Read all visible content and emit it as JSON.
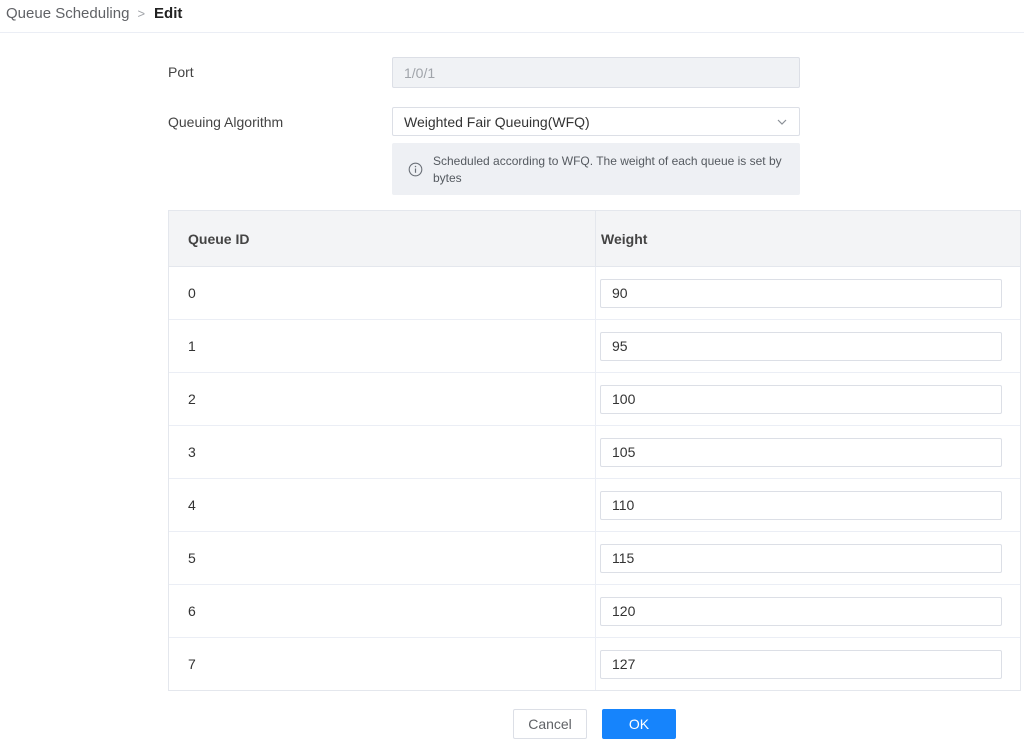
{
  "breadcrumb": {
    "parent": "Queue Scheduling",
    "separator": ">",
    "current": "Edit"
  },
  "form": {
    "port_label": "Port",
    "port_value": "1/0/1",
    "algorithm_label": "Queuing Algorithm",
    "algorithm_value": "Weighted Fair Queuing(WFQ)",
    "algorithm_icon": "chevron-down-icon",
    "info_icon": "info-circle-icon",
    "info_text": "Scheduled according to WFQ. The weight of each queue is set by bytes"
  },
  "table": {
    "headers": [
      "Queue ID",
      "Weight"
    ],
    "rows": [
      {
        "id": "0",
        "weight": "90"
      },
      {
        "id": "1",
        "weight": "95"
      },
      {
        "id": "2",
        "weight": "100"
      },
      {
        "id": "3",
        "weight": "105"
      },
      {
        "id": "4",
        "weight": "110"
      },
      {
        "id": "5",
        "weight": "115"
      },
      {
        "id": "6",
        "weight": "120"
      },
      {
        "id": "7",
        "weight": "127"
      }
    ]
  },
  "buttons": {
    "cancel": "Cancel",
    "ok": "OK"
  },
  "colors": {
    "primary": "#1684fc",
    "header_bg": "#f3f4f6",
    "info_bg": "#eef0f4"
  }
}
